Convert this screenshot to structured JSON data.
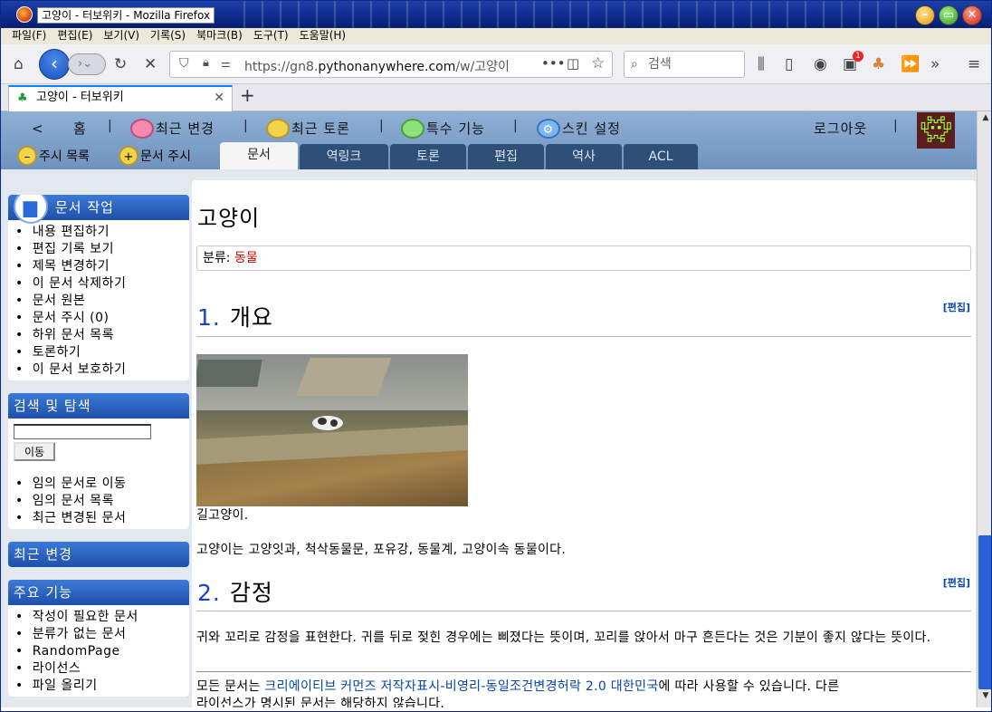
{
  "window": {
    "title": "고양이 - 터보위키 - Mozilla Firefox",
    "menu": [
      "파일(F)",
      "편집(E)",
      "보기(V)",
      "기록(S)",
      "북마크(B)",
      "도구(T)",
      "도움말(H)"
    ]
  },
  "browser": {
    "url_prefix": "https://gn8.",
    "url_domain": "pythonanywhere.com",
    "url_path": "/w/고양이",
    "search_placeholder": "검색",
    "tab_title": "고양이 - 터보위키",
    "notification_badge": "1",
    "accent_color": "#0a84ff"
  },
  "wiki_nav": {
    "back": "<",
    "home": "홈",
    "recent_changes": "최근 변경",
    "recent_discussion": "최근 토론",
    "special": "특수 기능",
    "skin_settings": "스킨 설정",
    "logout": "로그아웃",
    "watch_list": "주시 목록",
    "watch_doc": "문서 주시",
    "tabs": [
      "문서",
      "역링크",
      "토론",
      "편집",
      "역사",
      "ACL"
    ],
    "active_tab": "문서"
  },
  "sidebar": {
    "doc_work": {
      "title": "문서 작업",
      "items": [
        "내용 편집하기",
        "편집 기록 보기",
        "제목 변경하기",
        "이 문서 삭제하기",
        "문서 원본",
        "문서 주시 (0)",
        "하위 문서 목록",
        "토론하기",
        "이 문서 보호하기"
      ]
    },
    "search": {
      "title": "검색 및 탐색",
      "go_button": "이동",
      "items": [
        "임의 문서로 이동",
        "임의 문서 목록",
        "최근 변경된 문서"
      ]
    },
    "recent": {
      "title": "최근 변경"
    },
    "features": {
      "title": "주요 기능",
      "items": [
        "작성이 필요한 문서",
        "분류가 없는 문서",
        "RandomPage",
        "라이선스",
        "파일 올리기"
      ]
    }
  },
  "article": {
    "title": "고양이",
    "category_label": "분류:",
    "category": "동물",
    "sections": [
      {
        "num": "1.",
        "title": "개요",
        "edit": "[편집]"
      },
      {
        "num": "2.",
        "title": "감정",
        "edit": "[편집]"
      }
    ],
    "caption": "길고양이.",
    "intro": "고양이는 고양잇과, 척삭동물문, 포유강, 동물계, 고양이속 동물이다.",
    "emotion": "귀와 꼬리로 감정을 표현한다. 귀를 뒤로 젖힌 경우에는 삐졌다는 뜻이며, 꼬리를 앉아서 마구 흔든다는 것은 기분이 좋지 않다는 뜻이다.",
    "footer_pre": "모든 문서는",
    "footer_link": "크리에이티브 커먼즈 저작자표시-비영리-동일조건변경허락 2.0 대한민국",
    "footer_post": "에 따라 사용할 수 있습니다. 다른",
    "footer_line2": "라이선스가 명시된 문서는 해당하지 않습니다."
  }
}
